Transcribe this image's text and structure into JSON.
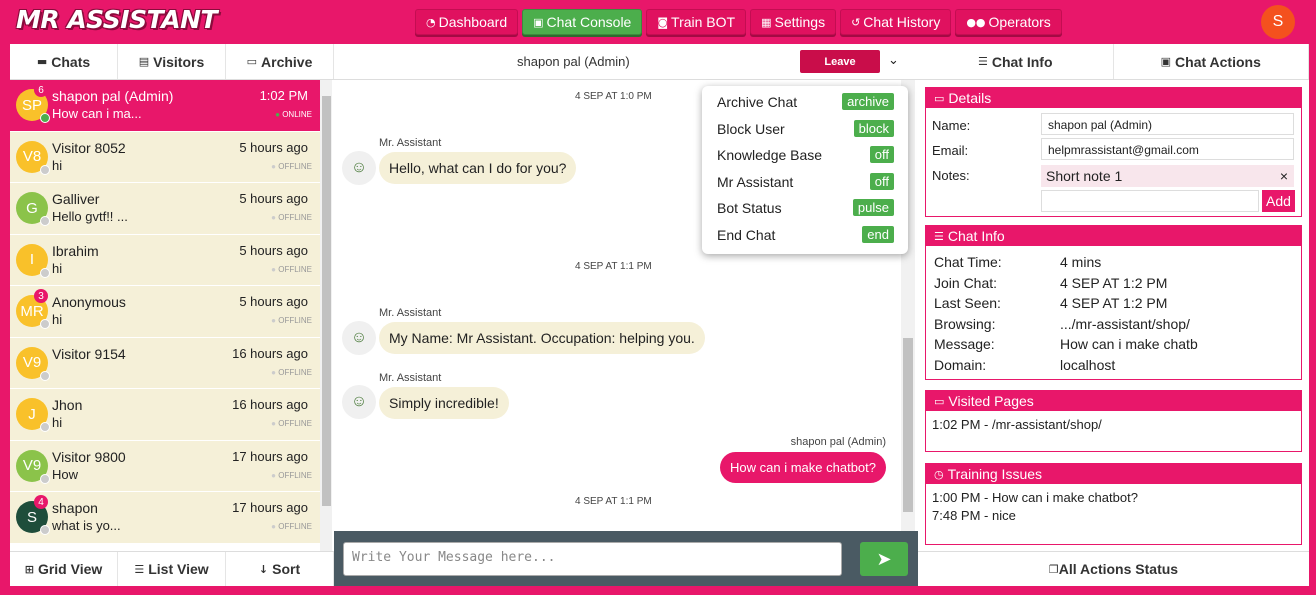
{
  "app": {
    "logo": "MR ASSISTANT",
    "user_initial": "S"
  },
  "nav": [
    {
      "label": "Dashboard",
      "icon": "dashboard-icon"
    },
    {
      "label": "Chat Console",
      "icon": "chat-icon",
      "active": true
    },
    {
      "label": "Train BOT",
      "icon": "robot-icon"
    },
    {
      "label": "Settings",
      "icon": "settings-icon"
    },
    {
      "label": "Chat History",
      "icon": "history-icon"
    },
    {
      "label": "Operators",
      "icon": "users-icon"
    }
  ],
  "left_tabs": [
    "Chats",
    "Visitors",
    "Archive"
  ],
  "chats": [
    {
      "initials": "SP",
      "name": "shapon pal (Admin)",
      "msg": "How can i ma...",
      "time": "1:02 PM",
      "status": "ONLINE",
      "badge": "6",
      "color": "#f9c12a",
      "selected": true
    },
    {
      "initials": "V8",
      "name": "Visitor 8052",
      "msg": "hi",
      "time": "5 hours ago",
      "status": "OFFLINE",
      "badge": "",
      "color": "#f9c12a"
    },
    {
      "initials": "G",
      "name": "Galliver",
      "msg": "Hello gvtf!! ...",
      "time": "5 hours ago",
      "status": "OFFLINE",
      "badge": "",
      "color": "#8bc34a"
    },
    {
      "initials": "I",
      "name": "Ibrahim",
      "msg": "hi",
      "time": "5 hours ago",
      "status": "OFFLINE",
      "badge": "",
      "color": "#f9c12a"
    },
    {
      "initials": "MR",
      "name": "Anonymous",
      "msg": "hi",
      "time": "5 hours ago",
      "status": "OFFLINE",
      "badge": "3",
      "color": "#f9c12a"
    },
    {
      "initials": "V9",
      "name": "Visitor 9154",
      "msg": "",
      "time": "16 hours ago",
      "status": "OFFLINE",
      "badge": "",
      "color": "#f9c12a"
    },
    {
      "initials": "J",
      "name": "Jhon",
      "msg": "hi",
      "time": "16 hours ago",
      "status": "OFFLINE",
      "badge": "",
      "color": "#f9c12a"
    },
    {
      "initials": "V9",
      "name": "Visitor 9800",
      "msg": "How",
      "time": "17 hours ago",
      "status": "OFFLINE",
      "badge": "",
      "color": "#8bc34a"
    },
    {
      "initials": "S",
      "name": "shapon",
      "msg": "what is yo...",
      "time": "17 hours ago",
      "status": "OFFLINE",
      "badge": "4",
      "color": "#1e4d3b"
    }
  ],
  "left_bottom": [
    "Grid View",
    "List View",
    "Sort"
  ],
  "conversation": {
    "title": "shapon pal (Admin)",
    "leave_label": "Leave",
    "dates": [
      "4 SEP AT 1:0 PM",
      "4 SEP AT 1:1 PM",
      "4 SEP AT 1:1 PM"
    ],
    "messages": [
      {
        "sender": "Mr. Assistant",
        "text": "Hello, what can I do for you?"
      },
      {
        "sender": "Mr. Assistant",
        "text": "My Name: Mr Assistant. Occupation: helping you."
      },
      {
        "sender": "Mr. Assistant",
        "text": "Simply incredible!"
      },
      {
        "sender": "shapon pal (Admin)",
        "text": "How can i make chatbot?"
      }
    ],
    "input_placeholder": "Write Your Message here..."
  },
  "actions_menu": [
    {
      "label": "Archive Chat",
      "tag": "archive"
    },
    {
      "label": "Block User",
      "tag": "block"
    },
    {
      "label": "Knowledge Base",
      "tag": "off"
    },
    {
      "label": "Mr Assistant",
      "tag": "off"
    },
    {
      "label": "Bot Status",
      "tag": "pulse"
    },
    {
      "label": "End Chat",
      "tag": "end"
    }
  ],
  "right_tabs": [
    "Chat Info",
    "Chat Actions"
  ],
  "details": {
    "title": "Details",
    "name_label": "Name:",
    "name": "shapon pal (Admin)",
    "email_label": "Email:",
    "email": "helpmrassistant@gmail.com",
    "notes_label": "Notes:",
    "note": "Short note 1",
    "add_label": "Add"
  },
  "chat_info": {
    "title": "Chat Info",
    "rows": [
      {
        "k": "Chat Time:",
        "v": "4 mins"
      },
      {
        "k": "Join Chat:",
        "v": "4 SEP AT 1:2 PM"
      },
      {
        "k": "Last Seen:",
        "v": "4 SEP AT 1:2 PM"
      },
      {
        "k": "Browsing:",
        "v": ".../mr-assistant/shop/"
      },
      {
        "k": "Message:",
        "v": "How can i make chatb"
      },
      {
        "k": "Domain:",
        "v": "localhost"
      }
    ]
  },
  "visited": {
    "title": "Visited Pages",
    "items": [
      "1:02 PM - /mr-assistant/shop/"
    ]
  },
  "training": {
    "title": "Training Issues",
    "items": [
      "1:00 PM - How can i make chatbot?",
      "7:48 PM - nice"
    ]
  },
  "right_bottom": "All Actions Status"
}
